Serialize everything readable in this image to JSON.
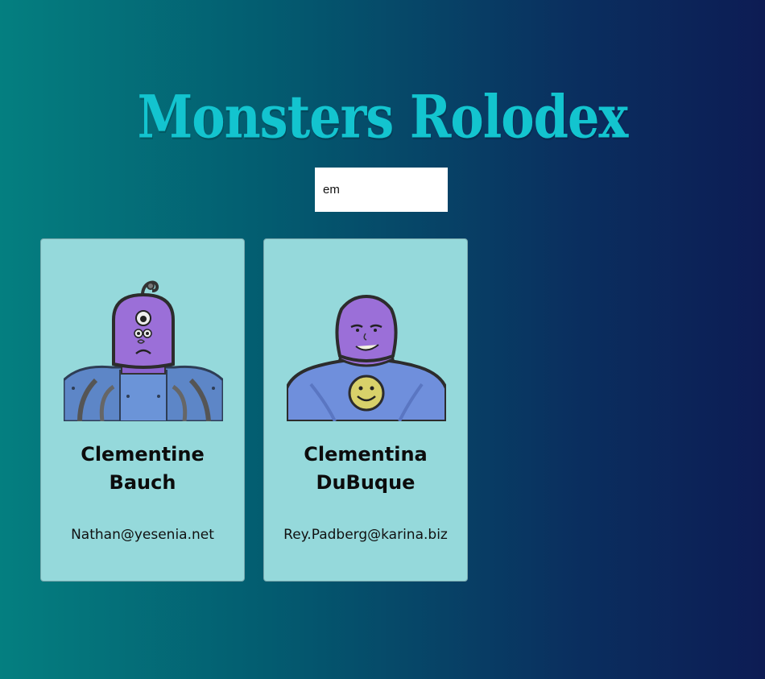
{
  "app": {
    "title": "Monsters Rolodex"
  },
  "search": {
    "value": "em",
    "placeholder": "search monsters"
  },
  "monsters": [
    {
      "name_line1": "Clementine",
      "name_line2": "Bauch",
      "email": "Nathan@yesenia.net",
      "avatar": "cyclops-robot-monster-icon"
    },
    {
      "name_line1": "Clementina",
      "name_line2": "DuBuque",
      "email": "Rey.Padberg@karina.biz",
      "avatar": "smiley-shirt-monster-icon"
    }
  ],
  "colors": {
    "title": "#13c4cf",
    "card": "#95d9db",
    "monster_skin": "#9b6fd8",
    "monster_body": "#6f8fdc"
  }
}
